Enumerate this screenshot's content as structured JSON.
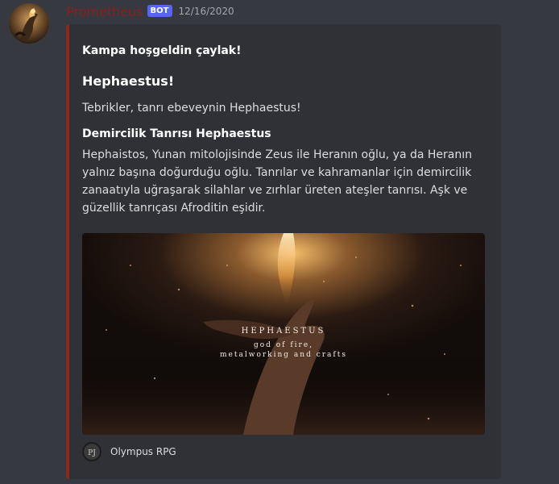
{
  "message": {
    "username": "Prometheus",
    "bot_tag": "BOT",
    "timestamp": "12/16/2020",
    "avatar_icon": "bot-avatar-icon"
  },
  "embed": {
    "accent_color": "#8b2b18",
    "author": "Kampa hoşgeldin çaylak!",
    "title": "Hephaestus!",
    "description": "Tebrikler, tanrı ebeveynin Hephaestus!",
    "field": {
      "name": "Demircilik Tanrısı Hephaestus",
      "value": "Hephaistos, Yunan mitolojisinde Zeus ile Heranın oğlu, ya da Heranın yalnız başına doğurduğu oğlu. Tanrılar ve kahramanlar için demircilik zanaatıyla uğraşarak silahlar ve zırhlar üreten ateşler tanrısı. Aşk ve güzellik tanrıçası Afroditin eşidir."
    },
    "image": {
      "title": "HEPHAESTUS",
      "subtitle_line1": "god of fire,",
      "subtitle_line2": "metalworking and crafts"
    },
    "footer": {
      "text": "Olympus RPG",
      "icon": "olympus-rpg-icon",
      "icon_text": "PJ"
    }
  },
  "colors": {
    "background": "#36393f",
    "embed_background": "#2f3136",
    "username": "#8b1e1e",
    "bot_tag": "#5865f2"
  }
}
